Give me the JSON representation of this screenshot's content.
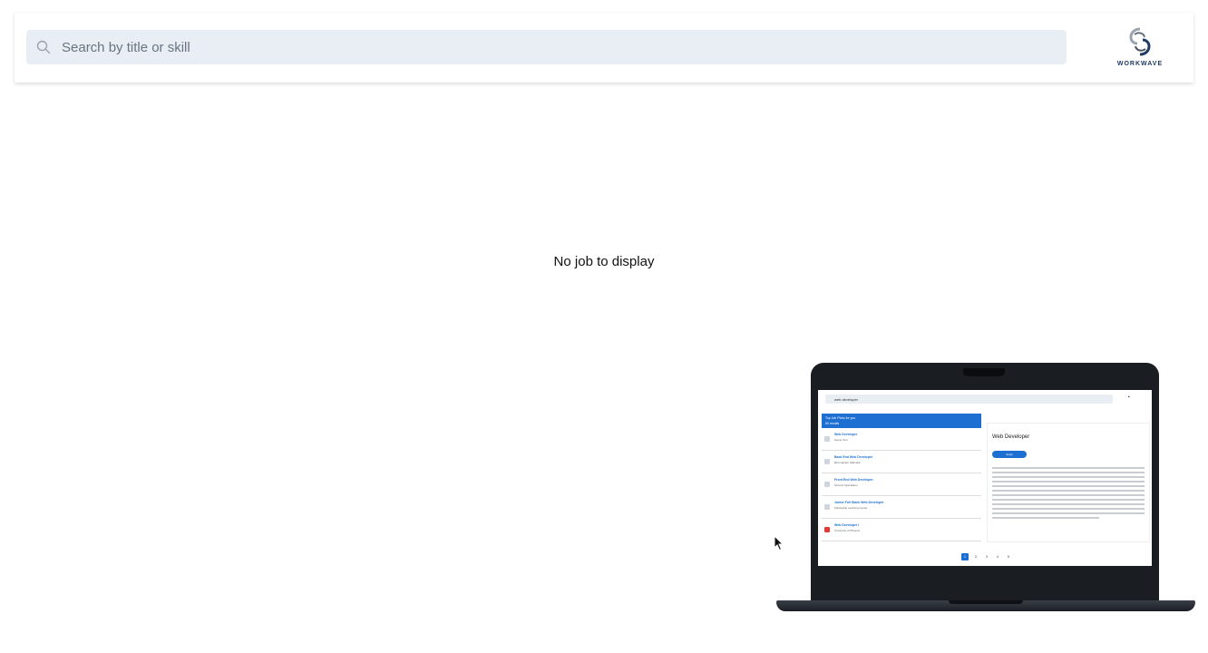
{
  "header": {
    "search_placeholder": "Search by title or skill",
    "logo_text": "WORKWAVE"
  },
  "main": {
    "empty_message": "No job to display"
  },
  "illustration": {
    "search_value": "web developer",
    "picks_title": "Top Job Picks for you",
    "picks_count": "50 results",
    "jobs": [
      {
        "title": "Web Developer",
        "company": "Game One"
      },
      {
        "title": "Back End Web Developer",
        "company": "Birmingham Hallmark"
      },
      {
        "title": "Front End Web Developer",
        "company": "Seneca Specialties"
      },
      {
        "title": "Junior Full Stack Web Developer",
        "company": "Fellowship Learning Center"
      },
      {
        "title": "Web Developer I",
        "company": "University of Phoenix"
      }
    ],
    "detail_title": "Web Developer",
    "apply_label": "Apply",
    "pages": [
      "1",
      "2",
      "3",
      "4",
      "5"
    ]
  },
  "colors": {
    "accent": "#1d6fd1",
    "search_bg": "#e9eef4",
    "logo_navy": "#1f3b64"
  }
}
